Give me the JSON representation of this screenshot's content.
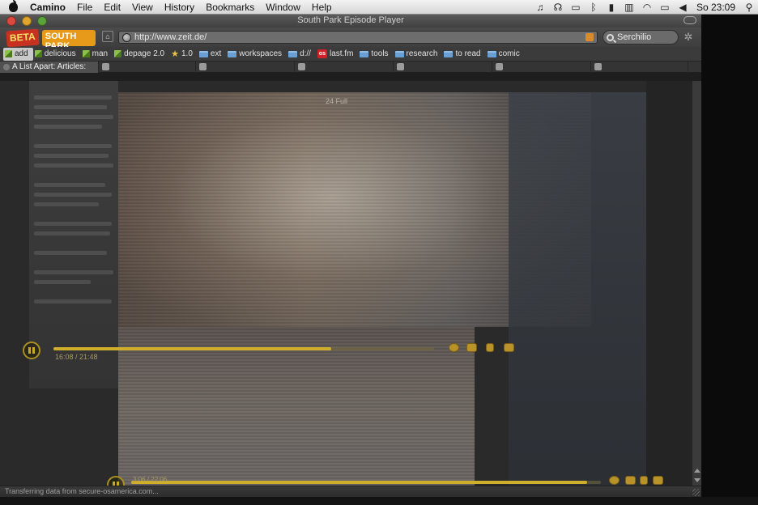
{
  "menubar": {
    "app_name": "Camino",
    "items": [
      "File",
      "Edit",
      "View",
      "History",
      "Bookmarks",
      "Window",
      "Help"
    ],
    "clock": "So 23:09"
  },
  "window": {
    "title": "South Park Episode Player"
  },
  "toolbar": {
    "logo_beta": "BETA",
    "logo_south": "SOUTH PARK",
    "url": "http://www.zeit.de/",
    "search_value": "Serchilio"
  },
  "bookmarks": [
    {
      "label": "add",
      "icon": "pen-icon"
    },
    {
      "label": "delicious",
      "icon": "pen-icon"
    },
    {
      "label": "man",
      "icon": "pen-icon"
    },
    {
      "label": "depage 2.0",
      "icon": "pen-icon"
    },
    {
      "label": "1.0",
      "icon": "star-icon"
    },
    {
      "label": "ext",
      "icon": "folder-icon"
    },
    {
      "label": "workspaces",
      "icon": "folder-icon"
    },
    {
      "label": "d://",
      "icon": "folder-icon"
    },
    {
      "label": "last.fm",
      "icon": "lastfm-icon"
    },
    {
      "label": "tools",
      "icon": "folder-icon"
    },
    {
      "label": "research",
      "icon": "folder-icon"
    },
    {
      "label": "to read",
      "icon": "folder-icon"
    },
    {
      "label": "comic",
      "icon": "folder-icon"
    }
  ],
  "tabs": [
    {
      "label": "A List Apart: Articles:"
    },
    {
      "label": ""
    },
    {
      "label": ""
    },
    {
      "label": ""
    },
    {
      "label": ""
    },
    {
      "label": ""
    },
    {
      "label": ""
    }
  ],
  "player": {
    "upper_time": "16:08 / 21:48",
    "lower_time": "3:06 / 22:06",
    "upper_progress": 0.73,
    "lower_progress": 0.97,
    "video_label": "24 Full"
  },
  "statusbar": {
    "text": "Transferring data from secure-osamerica.com..."
  }
}
